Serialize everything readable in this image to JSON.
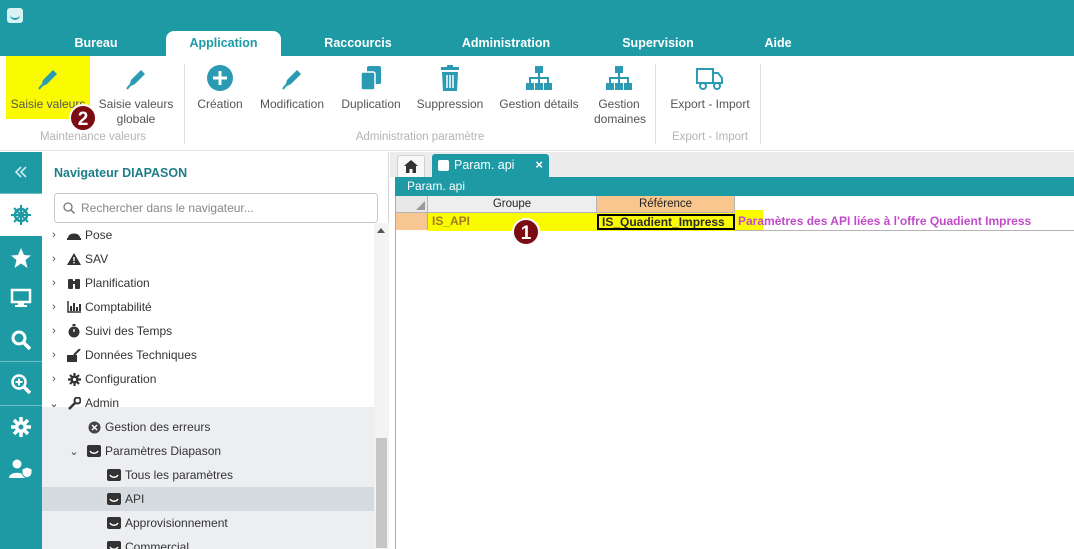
{
  "menu": {
    "tabs": [
      {
        "label": "Bureau"
      },
      {
        "label": "Application"
      },
      {
        "label": "Raccourcis"
      },
      {
        "label": "Administration"
      },
      {
        "label": "Supervision"
      },
      {
        "label": "Aide"
      }
    ],
    "active_tab": "Application"
  },
  "ribbon": {
    "buttons": [
      {
        "label": "Saisie valeurs",
        "icon": "pen-icon",
        "highlighted": true
      },
      {
        "label": "Saisie valeurs globale",
        "icon": "pen-icon"
      },
      {
        "label": "Création",
        "icon": "plus-circle-icon"
      },
      {
        "label": "Modification",
        "icon": "pen-icon"
      },
      {
        "label": "Duplication",
        "icon": "copy-icon"
      },
      {
        "label": "Suppression",
        "icon": "trash-icon"
      },
      {
        "label": "Gestion détails",
        "icon": "hierarchy-icon"
      },
      {
        "label": "Gestion domaines",
        "icon": "hierarchy-icon"
      },
      {
        "label": "Export - Import",
        "icon": "truck-icon"
      }
    ],
    "groups": {
      "maintenance": "Maintenance valeurs",
      "admin": "Administration paramètre",
      "export": "Export - Import"
    }
  },
  "annotations": {
    "badge_1": "1",
    "badge_2": "2"
  },
  "rail": {
    "items": [
      "collapse-icon",
      "helm-icon",
      "star-icon",
      "monitor-icon",
      "search-icon",
      "zoom-in-icon",
      "gear-icon",
      "user-shield-icon"
    ]
  },
  "navigator": {
    "title": "Navigateur DIAPASON",
    "search_placeholder": "Rechercher dans le navigateur...",
    "tree": [
      {
        "label": "Pose",
        "icon": "hardhat-icon",
        "expanded": false
      },
      {
        "label": "SAV",
        "icon": "warning-icon",
        "expanded": false
      },
      {
        "label": "Planification",
        "icon": "binoculars-icon",
        "expanded": false
      },
      {
        "label": "Comptabilité",
        "icon": "barchart-icon",
        "expanded": false
      },
      {
        "label": "Suivi des Temps",
        "icon": "stopwatch-icon",
        "expanded": false
      },
      {
        "label": "Données Techniques",
        "icon": "tools-icon",
        "expanded": false
      },
      {
        "label": "Configuration",
        "icon": "gear-icon",
        "expanded": false
      },
      {
        "label": "Admin",
        "icon": "wrench-icon",
        "expanded": true
      },
      {
        "label": "Gestion des erreurs",
        "icon": "error-icon"
      },
      {
        "label": "Paramètres Diapason",
        "icon": "diapason-icon",
        "expanded": true
      },
      {
        "label": "Tous les paramètres",
        "icon": "diapason-icon"
      },
      {
        "label": "API",
        "icon": "diapason-icon",
        "selected": true
      },
      {
        "label": "Approvisionnement",
        "icon": "diapason-icon"
      },
      {
        "label": "Commercial",
        "icon": "diapason-icon"
      }
    ]
  },
  "tabs": {
    "active": "Param. api",
    "close": "×"
  },
  "panel": {
    "title": "Param. api"
  },
  "grid": {
    "headers": [
      "Groupe",
      "Référence"
    ],
    "rows": [
      {
        "groupe": "IS_API",
        "reference": "IS_Quadient_Impress",
        "description": "Paramètres des API liées à l'offre Quadient Impress"
      }
    ]
  },
  "colors": {
    "teal": "#1e9aa5",
    "highlight": "#fbfb00",
    "badge": "#7a0c12",
    "description_text": "#c24acb"
  }
}
